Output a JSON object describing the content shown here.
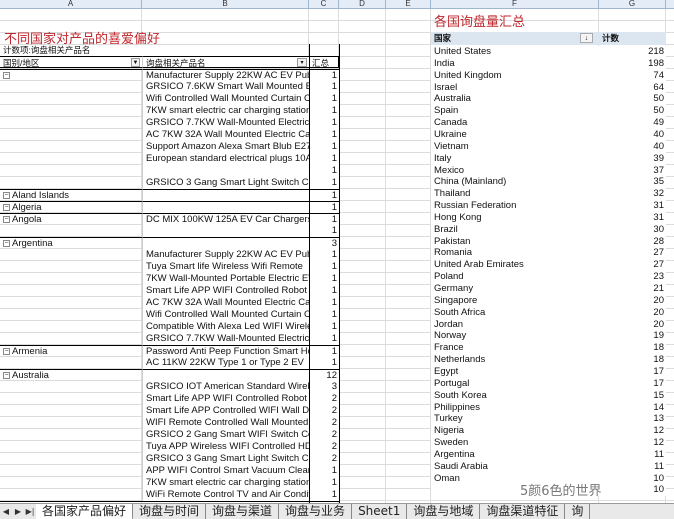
{
  "columns": [
    "A",
    "B",
    "C",
    "D",
    "E",
    "F",
    "G"
  ],
  "left": {
    "title": "不同国家对产品的喜爱偏好",
    "count_label": "计数项:询盘相关产品名",
    "header_country": "国别/地区",
    "header_product": "询盘相关产品名",
    "header_total": "汇总",
    "rows": [
      {
        "country": "",
        "g": 1,
        "product": "Manufacturer Supply 22KW AC EV Pub",
        "n": "1"
      },
      {
        "country": "",
        "product": "GRSICO 7.6KW Smart Wall Mounted E",
        "n": "1"
      },
      {
        "country": "",
        "product": "Wifi Controlled Wall Mounted Curtain C",
        "n": "1"
      },
      {
        "country": "",
        "product": "7KW smart electric car charging station",
        "n": "1"
      },
      {
        "country": "",
        "product": "GRSICO 7.7KW Wall-Mounted Electric",
        "n": "1"
      },
      {
        "country": "",
        "product": "AC 7KW 32A Wall Mounted Electric Ca",
        "n": "1"
      },
      {
        "country": "",
        "product": "Support Amazon Alexa Smart Blub E27",
        "n": "1"
      },
      {
        "country": "",
        "product": "European standard electrical plugs 10A",
        "n": "1"
      },
      {
        "country": "",
        "product": "",
        "n": "1"
      },
      {
        "country": "",
        "product": "GRSICO 3 Gang Smart Light Switch Co",
        "n": "1"
      },
      {
        "country": "Aland Islands",
        "g": 1,
        "product": "",
        "n": "1"
      },
      {
        "country": "Algeria",
        "g": 1,
        "product": "",
        "n": "1"
      },
      {
        "country": "Angola",
        "g": 1,
        "product": "DC MIX 100KW 125A EV Car Chargers",
        "n": "1"
      },
      {
        "country": "",
        "product": "",
        "n": "1"
      },
      {
        "country": "Argentina",
        "g": 1,
        "product": "",
        "n": "3"
      },
      {
        "country": "",
        "product": "Manufacturer Supply 22KW AC EV Pub",
        "n": "1"
      },
      {
        "country": "",
        "product": "Tuya Smart life Wireless Wifi Remote",
        "n": "1"
      },
      {
        "country": "",
        "product": "7KW Wall-Mounted Portable Electric EV",
        "n": "1"
      },
      {
        "country": "",
        "product": "Smart Life APP WIFI Controlled Robot",
        "n": "1"
      },
      {
        "country": "",
        "product": "AC 7KW 32A Wall Mounted Electric Ca",
        "n": "1"
      },
      {
        "country": "",
        "product": "Wifi Controlled Wall Mounted Curtain C",
        "n": "1"
      },
      {
        "country": "",
        "product": "Compatible With Alexa Led WIFI Wirele",
        "n": "1"
      },
      {
        "country": "",
        "product": "GRSICO 7.7KW Wall-Mounted Electric",
        "n": "1"
      },
      {
        "country": "Armenia",
        "g": 1,
        "product": "Password Anti Peep Function Smart Ho",
        "n": "1"
      },
      {
        "country": "",
        "product": "AC 11KW 22KW Type 1 or Type 2 EV",
        "n": "1"
      },
      {
        "country": "Australia",
        "g": 1,
        "product": "",
        "n": "12"
      },
      {
        "country": "",
        "product": "GRSICO IOT American Standard Wirele",
        "n": "3"
      },
      {
        "country": "",
        "product": "Smart Life APP WIFI Controlled Robot",
        "n": "2"
      },
      {
        "country": "",
        "product": "Smart Life APP Controlled WIFI Wall D",
        "n": "2"
      },
      {
        "country": "",
        "product": "WIFI Remote Controlled Wall Mounted",
        "n": "2"
      },
      {
        "country": "",
        "product": "GRSICO 2 Gang Smart WIFI Switch Co",
        "n": "2"
      },
      {
        "country": "",
        "product": "Tuya APP Wireless WIFI Controlled HD",
        "n": "2"
      },
      {
        "country": "",
        "product": "GRSICO 3 Gang Smart Light Switch Co",
        "n": "2"
      },
      {
        "country": "",
        "product": "APP WIFI Control Smart Vacuum Clear",
        "n": "1"
      },
      {
        "country": "",
        "product": "7KW smart electric car charging station",
        "n": "1"
      },
      {
        "country": "",
        "product": "WiFi Remote Control TV and Air Condit",
        "n": "1"
      }
    ]
  },
  "right": {
    "title": "各国询盘量汇总",
    "header_country": "国家",
    "header_count": "计数",
    "rows": [
      [
        "United States",
        "218"
      ],
      [
        "India",
        "198"
      ],
      [
        "United Kingdom",
        "74"
      ],
      [
        "Israel",
        "64"
      ],
      [
        "Australia",
        "50"
      ],
      [
        "Spain",
        "50"
      ],
      [
        "Canada",
        "49"
      ],
      [
        "Ukraine",
        "40"
      ],
      [
        "Vietnam",
        "40"
      ],
      [
        "Italy",
        "39"
      ],
      [
        "Mexico",
        "37"
      ],
      [
        "China (Mainland)",
        "35"
      ],
      [
        "Thailand",
        "32"
      ],
      [
        "Russian Federation",
        "31"
      ],
      [
        "Hong Kong",
        "31"
      ],
      [
        "Brazil",
        "30"
      ],
      [
        "Pakistan",
        "28"
      ],
      [
        "Romania",
        "27"
      ],
      [
        "United Arab Emirates",
        "27"
      ],
      [
        "Poland",
        "23"
      ],
      [
        "Germany",
        "21"
      ],
      [
        "Singapore",
        "20"
      ],
      [
        "South Africa",
        "20"
      ],
      [
        "Jordan",
        "20"
      ],
      [
        "Norway",
        "19"
      ],
      [
        "France",
        "18"
      ],
      [
        "Netherlands",
        "18"
      ],
      [
        "Egypt",
        "17"
      ],
      [
        "Portugal",
        "17"
      ],
      [
        "South Korea",
        "15"
      ],
      [
        "Philippines",
        "14"
      ],
      [
        "Turkey",
        "13"
      ],
      [
        "Nigeria",
        "12"
      ],
      [
        "Sweden",
        "12"
      ],
      [
        "Argentina",
        "11"
      ],
      [
        "Saudi Arabia",
        "11"
      ],
      [
        "Oman",
        "10"
      ],
      [
        "",
        "10"
      ]
    ]
  },
  "tabs": [
    "各国家产品偏好",
    "询盘与时间",
    "询盘与渠道",
    "询盘与业务",
    "Sheet1",
    "询盘与地域",
    "询盘渠道特征",
    "询"
  ],
  "watermark": "5颜6色的世界"
}
